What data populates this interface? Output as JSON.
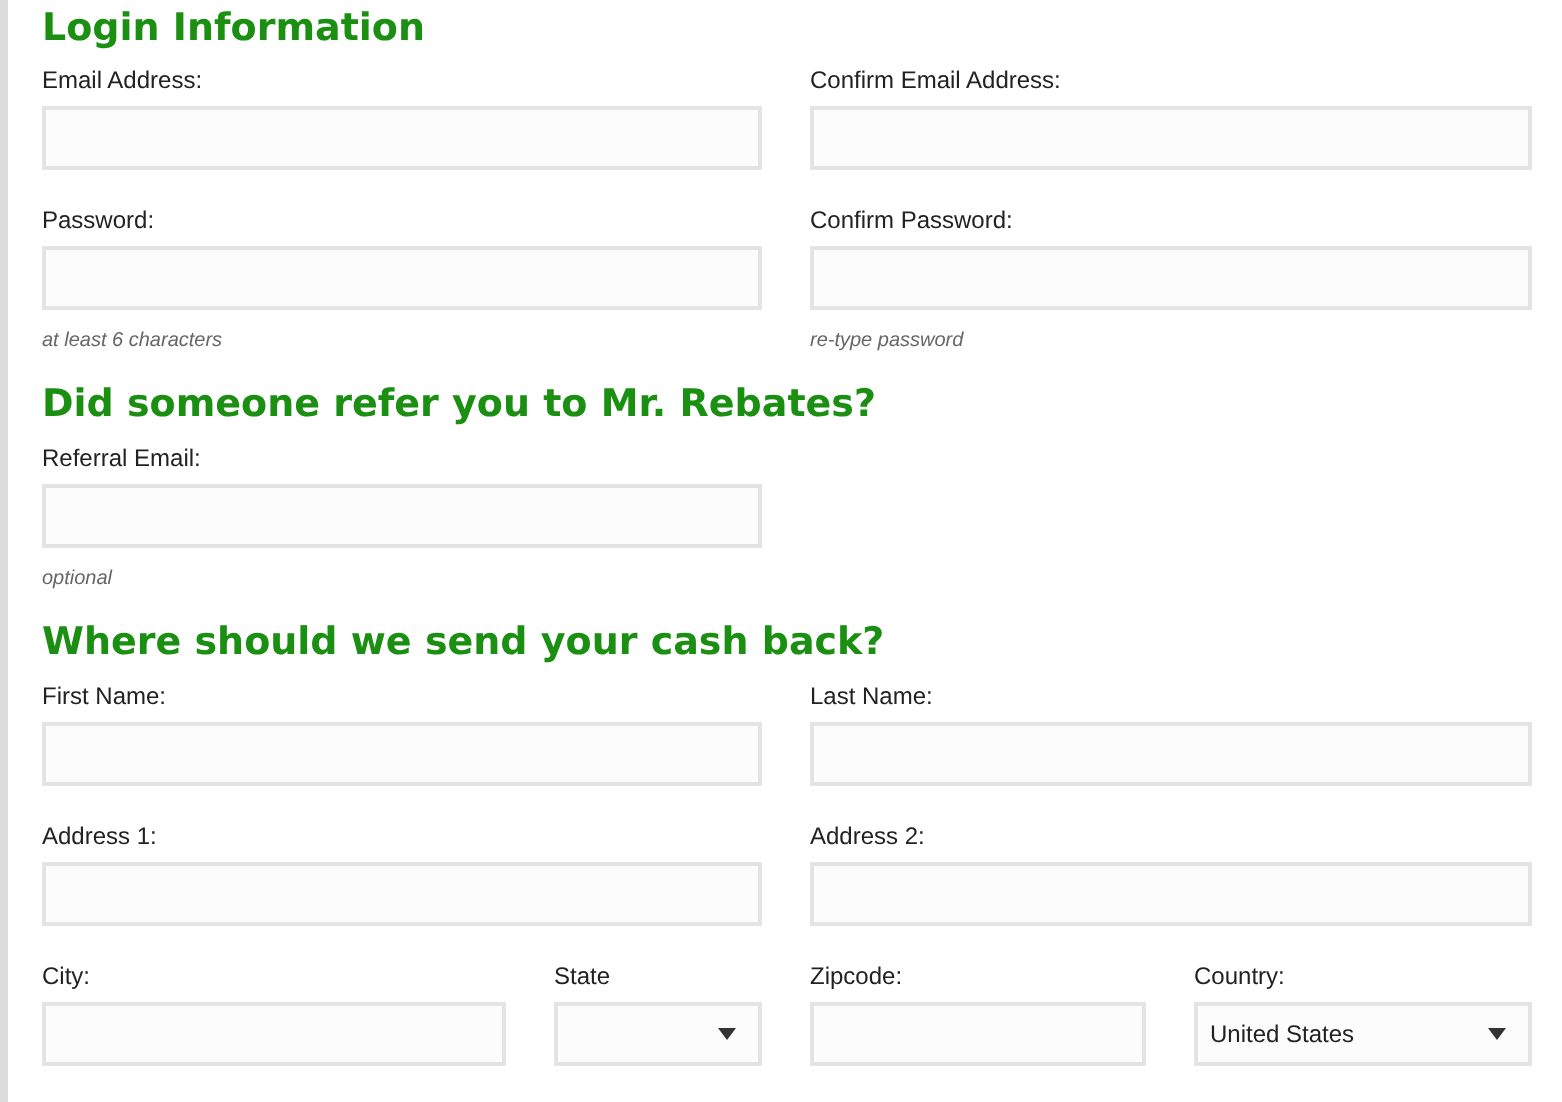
{
  "sections": [
    {
      "heading": "Login Information",
      "rows": [
        {
          "fields": [
            {
              "label": "Email Address:",
              "kind": "text"
            },
            {
              "label": "Confirm Email Address:",
              "kind": "text"
            }
          ]
        },
        {
          "fields": [
            {
              "label": "Password:",
              "kind": "text",
              "hint": "at least 6 characters"
            },
            {
              "label": "Confirm Password:",
              "kind": "text",
              "hint": "re-type password"
            }
          ]
        }
      ]
    },
    {
      "heading": "Did someone refer you to Mr. Rebates?",
      "rows": [
        {
          "fields": [
            {
              "label": "Referral Email:",
              "kind": "text",
              "hint": "optional"
            }
          ]
        }
      ]
    },
    {
      "heading": "Where should we send your cash back?",
      "rows": [
        {
          "fields": [
            {
              "label": "First Name:",
              "kind": "text"
            },
            {
              "label": "Last Name:",
              "kind": "text"
            }
          ]
        },
        {
          "fields": [
            {
              "label": "Address 1:",
              "kind": "text"
            },
            {
              "label": "Address 2:",
              "kind": "text"
            }
          ]
        },
        {
          "fields": [
            {
              "label": "City:",
              "kind": "text"
            },
            {
              "label": "State",
              "kind": "select"
            },
            {
              "label": "Zipcode:",
              "kind": "text"
            },
            {
              "label": "Country:",
              "kind": "select",
              "value": "United States"
            }
          ]
        }
      ]
    }
  ]
}
